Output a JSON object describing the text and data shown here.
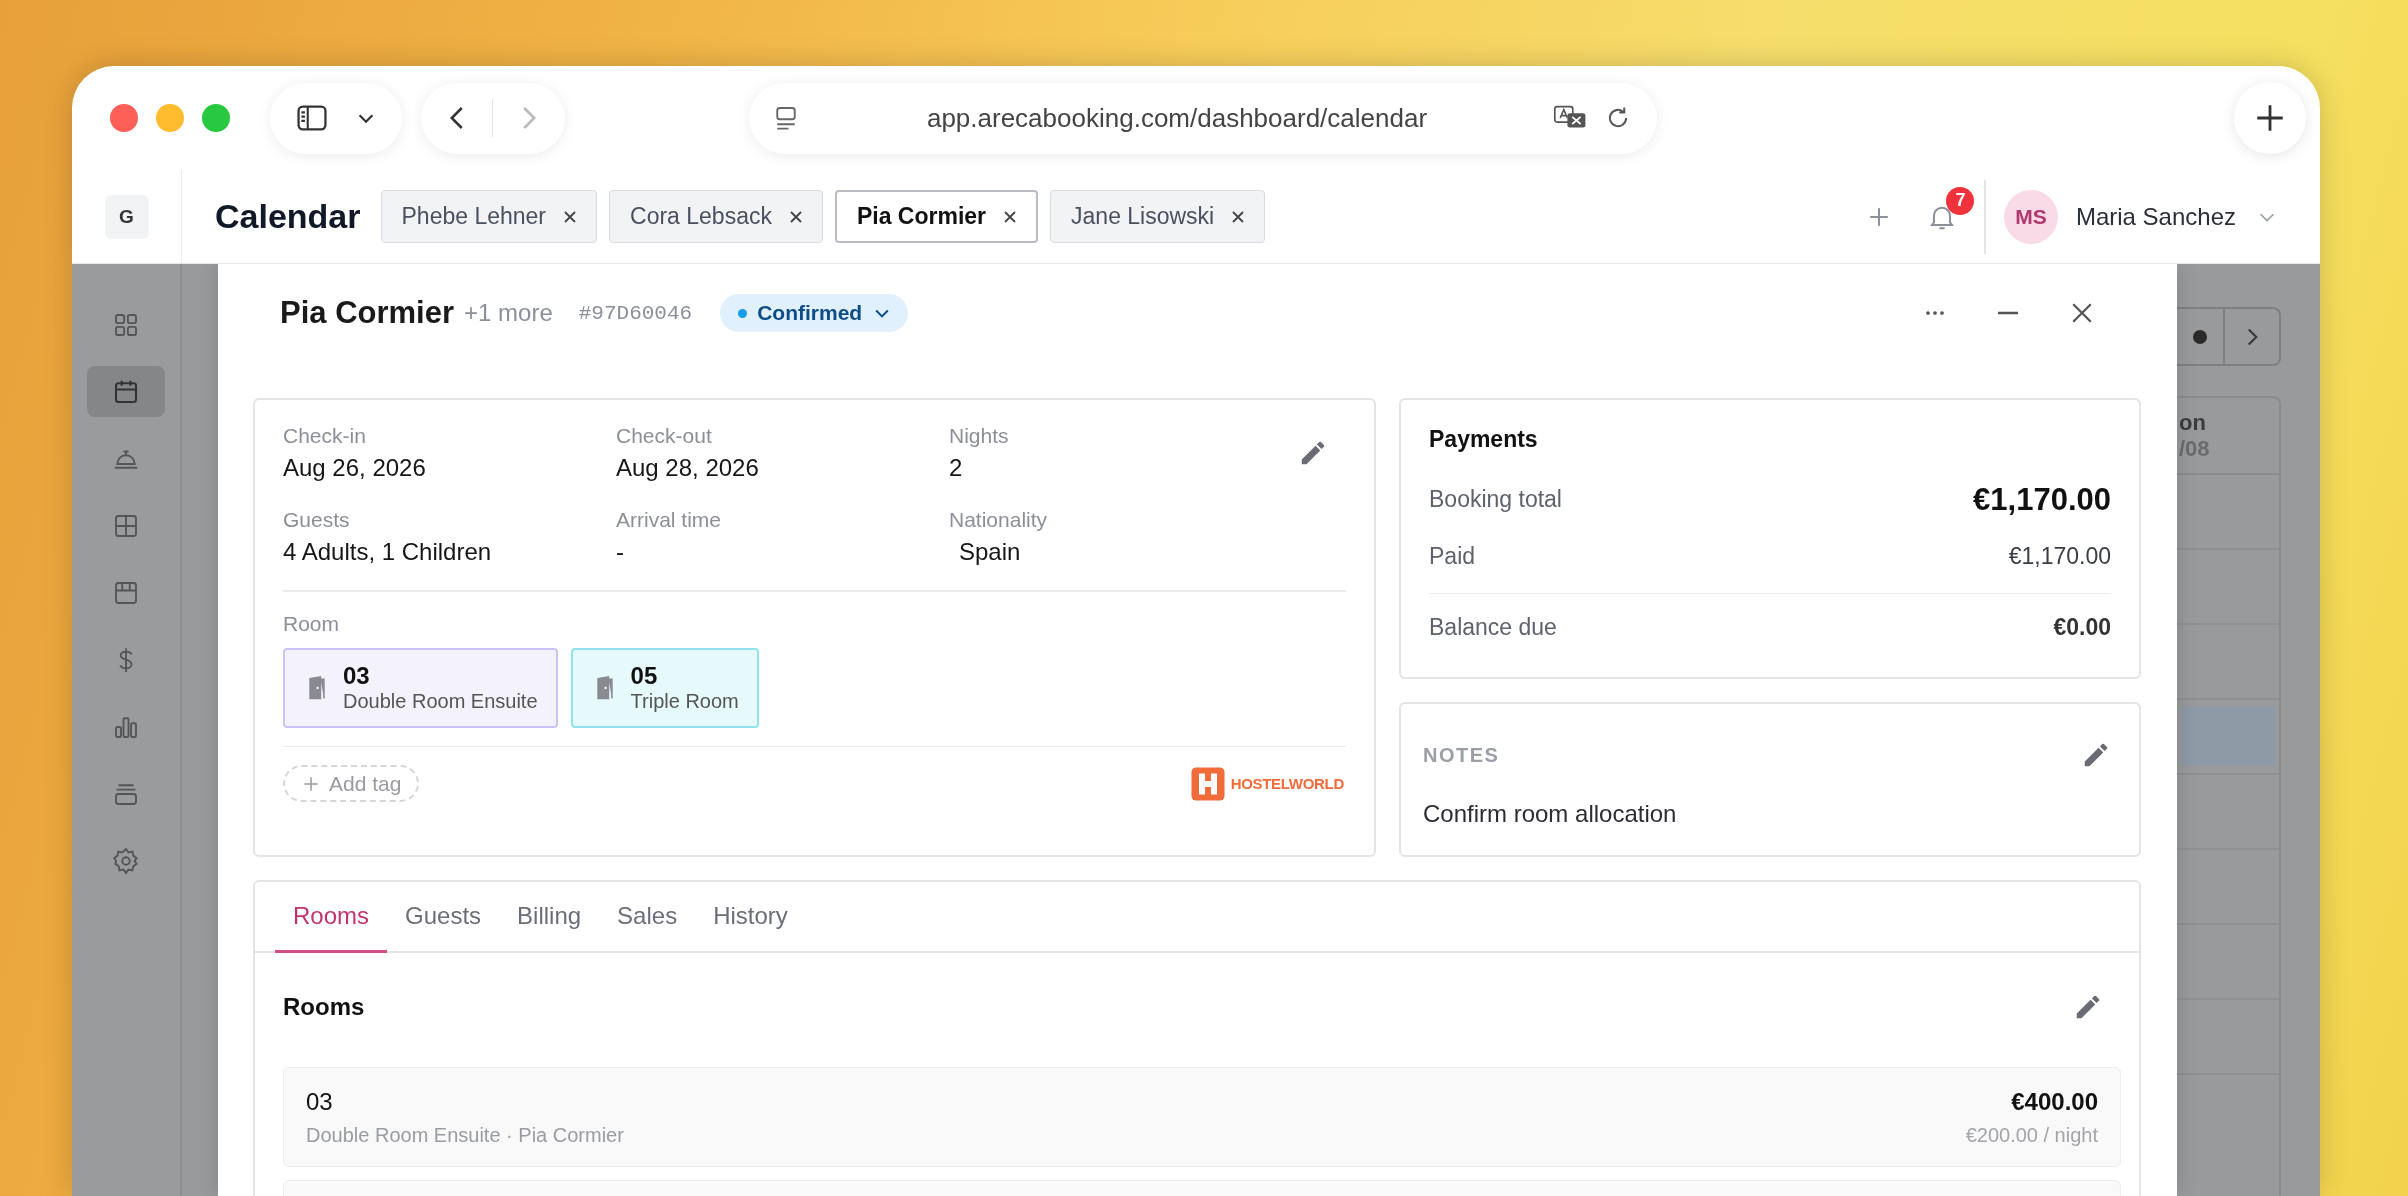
{
  "browser": {
    "url": "app.arecabooking.com/dashboard/calendar",
    "forward_disabled": true
  },
  "app": {
    "logo": "G",
    "page_title": "Calendar",
    "tabs": [
      {
        "label": "Phebe Lehner",
        "selected": false
      },
      {
        "label": "Cora Lebsack",
        "selected": false
      },
      {
        "label": "Pia Cormier",
        "selected": true
      },
      {
        "label": "Jane Lisowski",
        "selected": false
      }
    ],
    "notifications": "7",
    "user": {
      "initials": "MS",
      "name": "Maria Sanchez"
    }
  },
  "sidebar": {
    "items": [
      {
        "selected": false
      },
      {
        "selected": true
      },
      {
        "selected": false
      },
      {
        "selected": false
      },
      {
        "selected": false
      },
      {
        "selected": false
      },
      {
        "selected": false
      },
      {
        "selected": false
      },
      {
        "selected": false
      }
    ]
  },
  "background_calendar": {
    "column_day": "on",
    "column_date": "/08"
  },
  "booking": {
    "guest": "Pia Cormier",
    "extra_guests": "+1 more",
    "reference": "#97D60046",
    "status": "Confirmed",
    "fields": [
      {
        "label": "Check-in",
        "value": "Aug 26, 2026"
      },
      {
        "label": "Check-out",
        "value": "Aug 28, 2026"
      },
      {
        "label": "Nights",
        "value": "2"
      },
      {
        "label": "Guests",
        "value": "4 Adults, 1 Children"
      },
      {
        "label": "Arrival time",
        "value": "-"
      },
      {
        "label": "Nationality",
        "value": "Spain"
      }
    ],
    "room_label": "Room",
    "rooms": [
      {
        "number": "03",
        "type": "Double Room Ensuite",
        "color": "#cbc3f3"
      },
      {
        "number": "05",
        "type": "Triple Room",
        "color": "#8fe3ee"
      }
    ],
    "add_tag": "Add tag",
    "source": "HOSTELWORLD"
  },
  "payments": {
    "title": "Payments",
    "rows": [
      {
        "kind": "total",
        "label": "Booking total",
        "value": "€1,170.00"
      },
      {
        "kind": "paid",
        "label": "Paid",
        "value": "€1,170.00"
      },
      {
        "kind": "balance",
        "label": "Balance due",
        "value": "€0.00"
      }
    ]
  },
  "notes": {
    "title": "NOTES",
    "text": "Confirm room allocation"
  },
  "detail_tabs": [
    {
      "label": "Rooms",
      "selected": true
    },
    {
      "label": "Guests",
      "selected": false
    },
    {
      "label": "Billing",
      "selected": false
    },
    {
      "label": "Sales",
      "selected": false
    },
    {
      "label": "History",
      "selected": false
    }
  ],
  "rooms_section": {
    "title": "Rooms",
    "rows": [
      {
        "number": "03",
        "description": "Double Room Ensuite · Pia Cormier",
        "total": "€400.00",
        "rate": "€200.00 / night"
      }
    ]
  }
}
